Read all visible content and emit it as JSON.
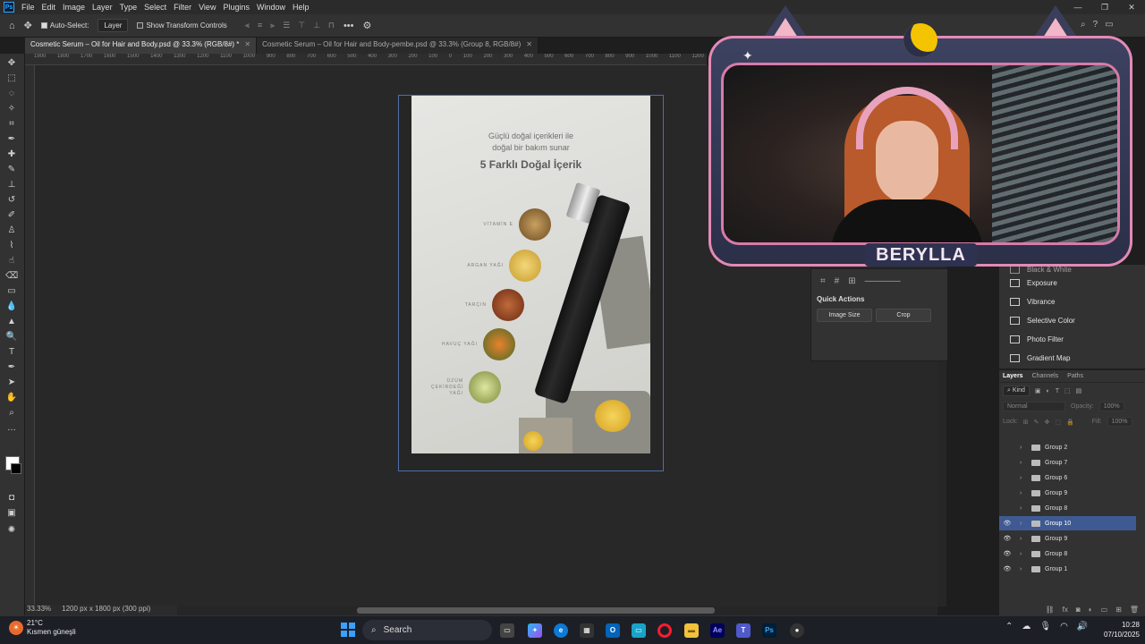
{
  "menubar": {
    "logo": "Ps",
    "items": [
      "File",
      "Edit",
      "Image",
      "Layer",
      "Type",
      "Select",
      "Filter",
      "View",
      "Plugins",
      "Window",
      "Help"
    ],
    "window_controls": [
      "—",
      "❐",
      "✕"
    ]
  },
  "options": {
    "auto_select_label": "Auto-Select:",
    "auto_select_checked": true,
    "target_value": "Layer",
    "transform_label": "Show Transform Controls",
    "transform_checked": false,
    "more": "•••"
  },
  "tabs": [
    {
      "title": "Cosmetic Serum – Oil for Hair and Body.psd @ 33.3% (RGB/8#) *",
      "active": true
    },
    {
      "title": "Cosmetic Serum – Oil for Hair and Body-pembe.psd @ 33.3% (Group 8, RGB/8#)",
      "active": false
    }
  ],
  "ruler_top": "1900 1800 1700 1600 1500 1400 1300 1200 1100 1000 900 800 700 600 500 400 300 200 100 0 100 200 300 400 500 600 700 800 900 1000 1100 1200 1300 1400 1500 1600 1700 1800 1900 2000 2100 2200 2300 2400",
  "document": {
    "line1": "Güçlü doğal içerikleri ile",
    "line2": "doğal bir bakım sunar",
    "headline": "5 Farklı Doğal İçerik",
    "ingredients": [
      {
        "label": "VİTAMİN E",
        "color": "#8a6a3a"
      },
      {
        "label": "ARGAN YAĞI",
        "color": "#d9b44a"
      },
      {
        "label": "TARÇIN",
        "color": "#9a4d2a"
      },
      {
        "label": "HAVUÇ YAĞI",
        "color": "#c9642a"
      },
      {
        "label": "ÜZÜM ÇEKİRDEĞİ YAĞI",
        "color": "#a7b45e"
      }
    ]
  },
  "status": {
    "zoom": "33.33%",
    "dimensions": "1200 px x 1800 px (300 ppi)"
  },
  "properties": {
    "quick_actions_title": "Quick Actions",
    "btn1": "Image Size",
    "btn2": "Crop"
  },
  "adjustments": {
    "items": [
      "Black & White",
      "Exposure",
      "Vibrance",
      "Selective Color",
      "Photo Filter",
      "Gradient Map"
    ]
  },
  "layers_panel": {
    "tabs": [
      "Layers",
      "Channels",
      "Paths"
    ],
    "kind": "Kind",
    "blend": "Normal",
    "opacity_label": "Opacity:",
    "opacity_value": "100%",
    "lock_label": "Lock:",
    "fill_label": "Fill:",
    "fill_value": "100%",
    "layers": [
      {
        "name": "Group 2",
        "visible": false,
        "selected": false
      },
      {
        "name": "Group 7",
        "visible": false,
        "selected": false
      },
      {
        "name": "Group 6",
        "visible": false,
        "selected": false
      },
      {
        "name": "Group 9",
        "visible": false,
        "selected": false
      },
      {
        "name": "Group 8",
        "visible": false,
        "selected": false
      },
      {
        "name": "Group 10",
        "visible": true,
        "selected": true
      },
      {
        "name": "Group 9",
        "visible": true,
        "selected": false
      },
      {
        "name": "Group 8",
        "visible": true,
        "selected": false
      },
      {
        "name": "Group 1",
        "visible": true,
        "selected": false
      }
    ]
  },
  "webcam": {
    "name": "BERYLLA"
  },
  "taskbar": {
    "temperature": "21°C",
    "weather": "Kısmen güneşli",
    "search_label": "Search",
    "time": "10:28",
    "date": "07/10/2025"
  },
  "colors": {
    "selection": "#3f5a93",
    "accent_pink": "#e38ab5",
    "artboard_border": "#4f6ea8"
  }
}
